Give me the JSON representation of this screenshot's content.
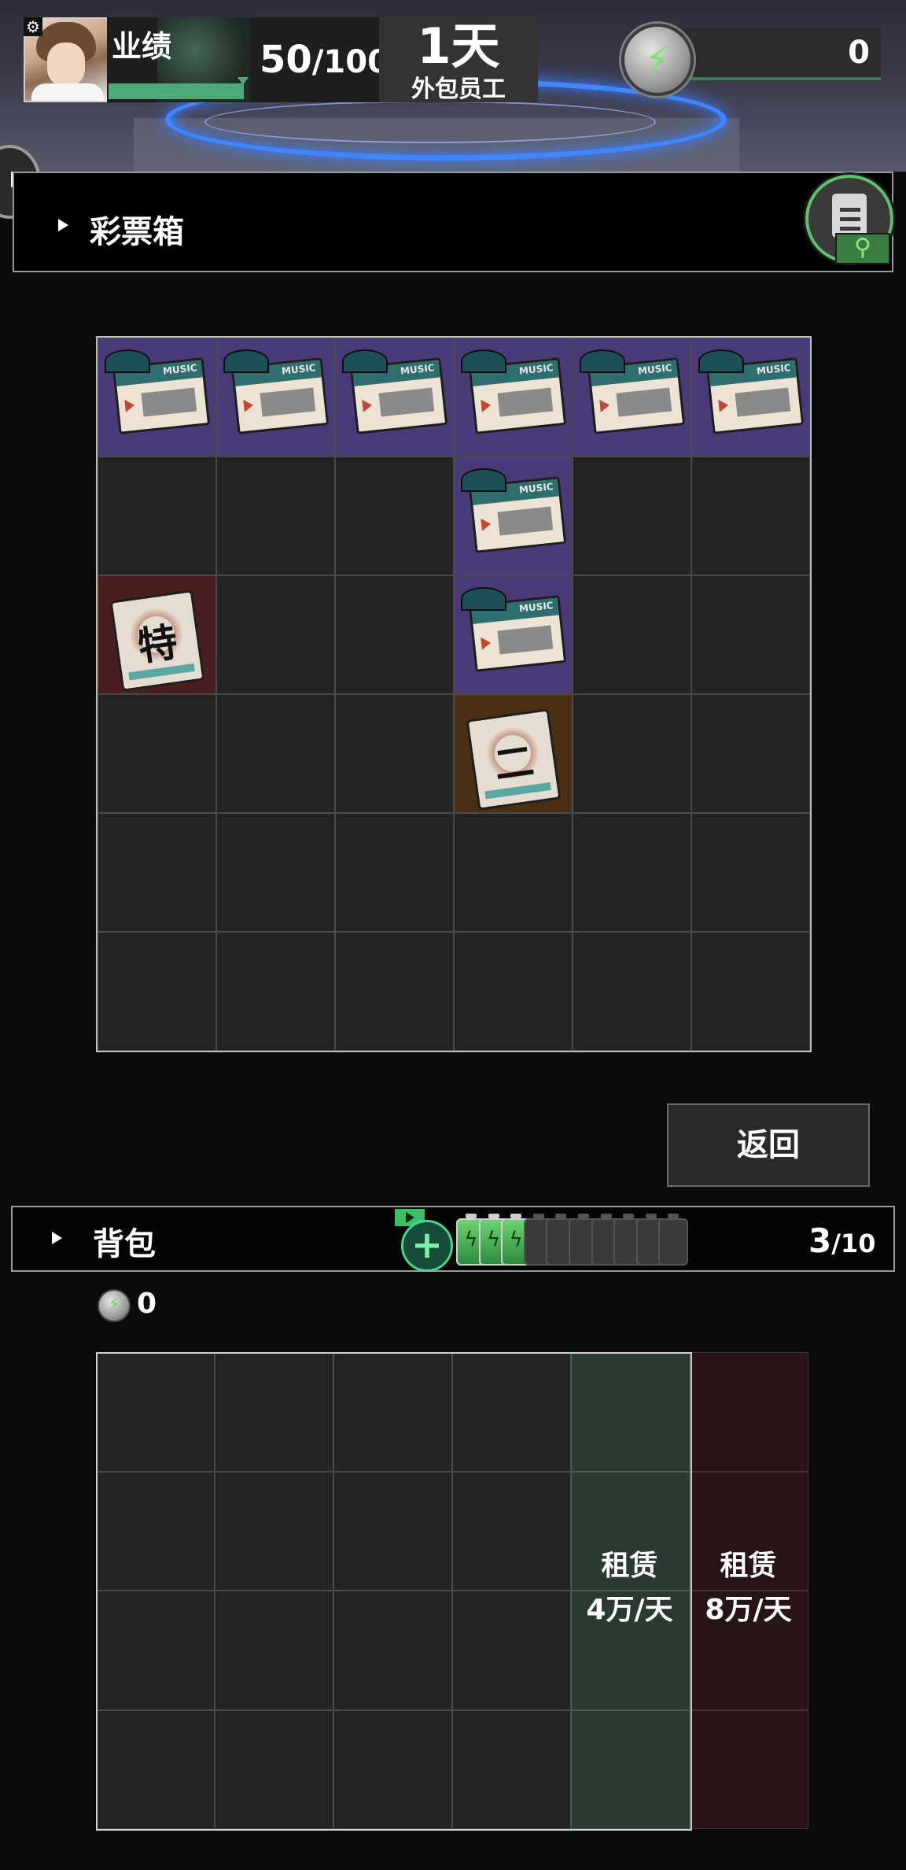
{
  "hud": {
    "performance_label": "业绩",
    "performance_current": "50",
    "performance_total": "/100",
    "day_value": "1天",
    "role_label": "外包员工",
    "energy_value": "0"
  },
  "lottery_box": {
    "title": "彩票箱",
    "ticket_brand": "MUSIC",
    "prize_special": "特",
    "prize_second": "二"
  },
  "return_button": "返回",
  "backpack": {
    "title": "背包",
    "capacity_used": "3",
    "capacity_total": "/10",
    "energy_coins": "0",
    "rent_4": {
      "line1": "租赁",
      "line2": "4万/天"
    },
    "rent_8": {
      "line1": "租赁",
      "line2": "8万/天"
    }
  }
}
